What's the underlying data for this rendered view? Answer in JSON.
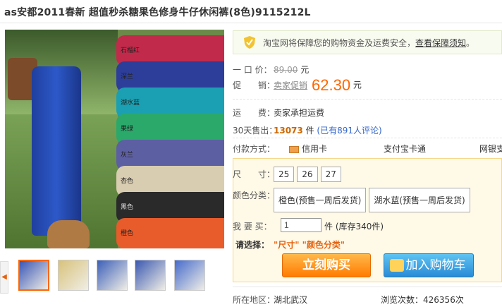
{
  "product": {
    "title": "as安都2011春新 超值秒杀糖果色修身牛仔休闲裤(8色)9115212L"
  },
  "gallery": {
    "color_labels": [
      "石榴红",
      "深兰",
      "湖水蓝",
      "果绿",
      "灰兰",
      "杏色",
      "黑色",
      "橙色"
    ],
    "pant_colors": [
      "#c22a4b",
      "#2d3e9a",
      "#1aa0b2",
      "#2aa96b",
      "#5d5fa3",
      "#d8ccb1",
      "#2a2a2a",
      "#e85b2a"
    ],
    "zoom_icon": "magnifier-icon",
    "thumb_colors": [
      "#3a56b5",
      "#d8c27a",
      "#3b5fb8",
      "#3a58b0",
      "#456bcb"
    ]
  },
  "guarantee": {
    "text": "淘宝网将保障您的购物资金及运费安全，",
    "link": "查看保障须知",
    "end": "。"
  },
  "info": {
    "price_label": "一 口 价：",
    "price_orig": "89.00",
    "price_unit": "元",
    "promo_label": "促　　销：",
    "promo_tag": "卖家促销",
    "promo_price": "62.30",
    "promo_unit": "元",
    "shipping_label": "运　　费：",
    "shipping_value": "卖家承担运费",
    "sold_label": "30天售出：",
    "sold_count": "13073",
    "sold_unit": "件",
    "reviews": "(已有891人评论)",
    "payment_label": "付款方式：",
    "pay_credit": "信用卡",
    "pay_alipay": "支付宝卡通",
    "pay_bank": "网银支"
  },
  "selection": {
    "size_label": "尺　　寸：",
    "sizes": [
      "25",
      "26",
      "27"
    ],
    "color_label": "颜色分类：",
    "colors": [
      "橙色(预售一周后发货)",
      "湖水蓝(预售一周后发货)"
    ],
    "qty_label": "我 要 买：",
    "qty_value": "1",
    "qty_unit": "件 (库存340件)",
    "choose_label": "请选择：",
    "choose_hint": "\"尺寸\" \"颜色分类\""
  },
  "actions": {
    "buy_now": "立刻购买",
    "add_cart": "加入购物车"
  },
  "footer": {
    "location_label": "所在地区：",
    "location_value": "湖北武汉",
    "views_label": "浏览次数：",
    "views_value": "426356次"
  }
}
